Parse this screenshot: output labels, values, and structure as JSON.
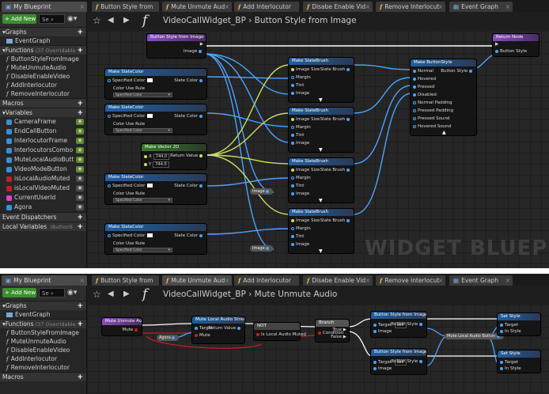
{
  "shot1": {
    "tabs": [
      {
        "label": "My Blueprint",
        "kind": "bp"
      },
      {
        "label": "Button Style from",
        "kind": "fn"
      },
      {
        "label": "Mute Unmute Aud",
        "kind": "fn"
      },
      {
        "label": "Add Interlocutor",
        "kind": "fn"
      },
      {
        "label": "Disabe Enable Vid",
        "kind": "fn"
      },
      {
        "label": "Remove Interlocut",
        "kind": "fn"
      },
      {
        "label": "Event Graph",
        "kind": "graph"
      }
    ],
    "toolbar": {
      "add_label": "+ Add New",
      "search_placeholder": "Se"
    },
    "graphs_header": "Graphs",
    "event_graph": "EventGraph",
    "functions_header": "Functions",
    "functions_count": "(37 Overridable",
    "functions": [
      "ButtonStyleFromImage",
      "MuteUnmuteAudio",
      "DisableEnableVideo",
      "AddInterlocutor",
      "RemoveInterlocutor"
    ],
    "macros_header": "Macros",
    "variables_header": "Variables",
    "variables": [
      {
        "name": "CameraFrame",
        "color": "#3a8fd8"
      },
      {
        "name": "EndCallButton",
        "color": "#3a8fd8"
      },
      {
        "name": "InterlocutorFrame",
        "color": "#3a8fd8"
      },
      {
        "name": "InterlocutorsCombo",
        "color": "#3a8fd8"
      },
      {
        "name": "MuteLocalAudioButt",
        "color": "#3a8fd8"
      },
      {
        "name": "VideoModeButton",
        "color": "#3a8fd8"
      },
      {
        "name": "isLocalAudioMuted",
        "color": "#c02020"
      },
      {
        "name": "isLocalVideoMuted",
        "color": "#c02020"
      },
      {
        "name": "CurrentUserId",
        "color": "#e040d0"
      },
      {
        "name": "Agora",
        "color": "#3a8fd8"
      }
    ],
    "event_dispatchers_header": "Event Dispatchers",
    "local_variables_header": "Local Variables",
    "local_variables_hint": "(ButtonS",
    "graph_title": "VideoCallWidget_BP",
    "graph_sub": "Button Style from Image",
    "watermark": "WIDGET BLUEPRI",
    "nodes": {
      "entry_title": "Button Style from Image",
      "entry_pin": "Image",
      "return_title": "Return Node",
      "return_pin": "Button Style",
      "make_slate_color": "Make SlateColor",
      "specified_color": "Specified Color",
      "slate_color": "Slate Color",
      "color_use_rule": "Color Use Rule",
      "color_use_value": "Specified Color",
      "make_vector": "Make Vector 2D",
      "vec_x_label": "X",
      "vec_x": "744.0",
      "vec_y_label": "Y",
      "vec_y": "744.0",
      "return_value": "Return Value",
      "make_slate_brush": "Make SlateBrush",
      "brush_pins": [
        "Image Size",
        "Margin",
        "Tint",
        "Image"
      ],
      "slate_brush": "Slate Brush",
      "make_button_style": "Make ButtonStyle",
      "button_style_pins": [
        "Normal",
        "Hovered",
        "Pressed",
        "Disabled",
        "Normal Padding",
        "Pressed Padding",
        "Pressed Sound",
        "Hovered Sound"
      ],
      "button_style_out": "Button Style",
      "image_reroute": "Image"
    }
  },
  "shot2": {
    "tabs": [
      {
        "label": "My Blueprint",
        "kind": "bp"
      },
      {
        "label": "Button Style from",
        "kind": "fn"
      },
      {
        "label": "Mute Unmute Aud",
        "kind": "fn"
      },
      {
        "label": "Add Interlocutor",
        "kind": "fn"
      },
      {
        "label": "Disabe Enable Vid",
        "kind": "fn"
      },
      {
        "label": "Remove Interlocut",
        "kind": "fn"
      },
      {
        "label": "Event Graph",
        "kind": "graph"
      }
    ],
    "toolbar": {
      "add_label": "+ Add New",
      "search_placeholder": "Se"
    },
    "graphs_header": "Graphs",
    "event_graph": "EventGraph",
    "functions_header": "Functions",
    "functions_count": "(37 Overridable",
    "functions": [
      "ButtonStyleFromImage",
      "MuteUnmuteAudio",
      "DisableEnableVideo",
      "AddInterlocutor",
      "RemoveInterlocutor"
    ],
    "macros_header": "Macros",
    "graph_title": "VideoCallWidget_BP",
    "graph_sub": "Mute Unmute Audio",
    "nodes": {
      "entry": "Mute Unmute Audio",
      "entry_pin": "Mute",
      "mute_local": "Mute Local Audio Stream",
      "target": "Target",
      "mute": "Mute",
      "return_value": "Return Value",
      "agora": "Agora",
      "not": "NOT",
      "is_local_muted": "Is Local Audio Muted",
      "branch": "Branch",
      "condition": "Condition",
      "true_label": "True",
      "false_label": "False",
      "button_style_from_image": "Button Style from Image",
      "target_self": "self",
      "image": "Image",
      "button_style": "Button Style",
      "set_style": "Set Style",
      "in_style": "In Style",
      "mute_local_btn": "Mute Local Audio Button"
    }
  }
}
